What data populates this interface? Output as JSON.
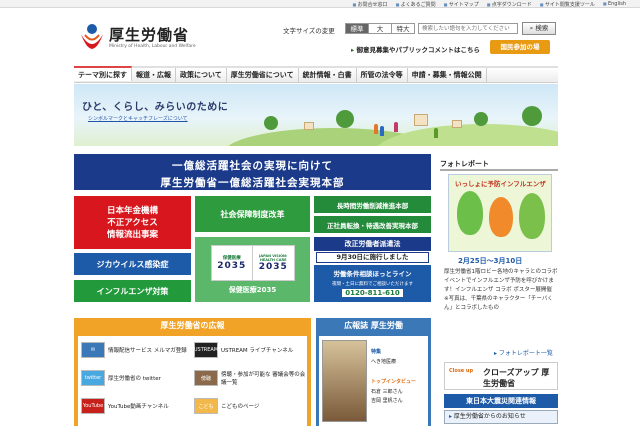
{
  "top_links": [
    "お問合せ窓口",
    "よくあるご質問",
    "サイトマップ",
    "点字ダウンロード",
    "サイト閲覧支援ツール",
    "English"
  ],
  "logo": {
    "title": "厚生労働省",
    "subtitle": "Ministry of Health, Labour and Welfare"
  },
  "font_size": {
    "label": "文字サイズの変更",
    "options": [
      "標準",
      "大",
      "特大"
    ],
    "selected": "標準"
  },
  "search": {
    "placeholder": "検索したい語句を入力してください",
    "button": "検索"
  },
  "header_links": {
    "public_comment": "御意見募集やパブリックコメントはこちら",
    "pension": "国民参加の場"
  },
  "nav": [
    "テーマ別に探す",
    "報道・広報",
    "政策について",
    "厚生労働省について",
    "統計情報・白書",
    "所管の法令等",
    "申請・募集・情報公開"
  ],
  "hero": {
    "text": "ひと、くらし、みらいのために",
    "link": "シンボルマークとキャッチフレーズについて"
  },
  "main_banner": {
    "line1": "一億総活躍社会の実現に向けて",
    "line2": "厚生労働省一億総活躍社会実現本部"
  },
  "tiles": {
    "pension_leak": [
      "日本年金機構",
      "不正アクセス",
      "情報流出事案"
    ],
    "zika": "ジカウイルス感染症",
    "influenza": "インフルエンザ対策",
    "social_security": "社会保障制度改革",
    "healthcare": {
      "jp": "保健医療",
      "num": "2035",
      "en": "JAPAN VISION: HEALTH CARE",
      "caption": "保健医療2035"
    },
    "overtime": "長時間労働削減推進本部",
    "regular_employee": "正社員転換・待遇改善実現本部",
    "dispatch_law": "改正労働者派遣法",
    "dispatch_date": "9月30日に施行しました",
    "hotline": {
      "title": "労働条件相談ほっとライン",
      "note": "夜間・土日に無料でご相談いただけます",
      "number": "0120-811-610"
    }
  },
  "kouhou": {
    "title": "厚生労働省の広報",
    "items": [
      {
        "icon": "mail",
        "label": "情報配信サービス メルマガ登録"
      },
      {
        "icon": "USTREAM",
        "label": "USTREAM ライブチャンネル"
      },
      {
        "icon": "twitter",
        "label": "厚生労働省の twitter"
      },
      {
        "icon": "傍聴",
        "label": "傍聴・参加が可能な 審議会等の会議一覧"
      },
      {
        "icon": "YouTube",
        "label": "YouTube動画チャンネル"
      },
      {
        "icon": "こども",
        "label": "こどものページ"
      }
    ]
  },
  "kouhoushi": {
    "title": "広報誌 厚生労働",
    "feature_label": "特集",
    "feature": "へき地医療",
    "interview_label": "トップインタビュー",
    "names": [
      "石倉 三郎さん",
      "吉岡 里帆さん"
    ]
  },
  "photo_report": {
    "title": "フォトレポート",
    "poster_title": "いっしょに予防インフルエンザ",
    "date": "2月25日～3月10日",
    "desc": "厚生労働省1階ロビー各地のキャラとのコラボイベントでインフルエンザ予防を呼びかけます！インフルエンザ コラボ ポスター展開催 ※写真は、千葉県のキャラクター「チーバくん」とコラボしたもの",
    "more": "フォトレポート一覧"
  },
  "closeup": {
    "small": "Close up",
    "big": "クローズアップ 厚生労働省"
  },
  "shinsai": {
    "title": "東日本大震災関連情報",
    "sub": "厚生労働省からのお知らせ"
  }
}
